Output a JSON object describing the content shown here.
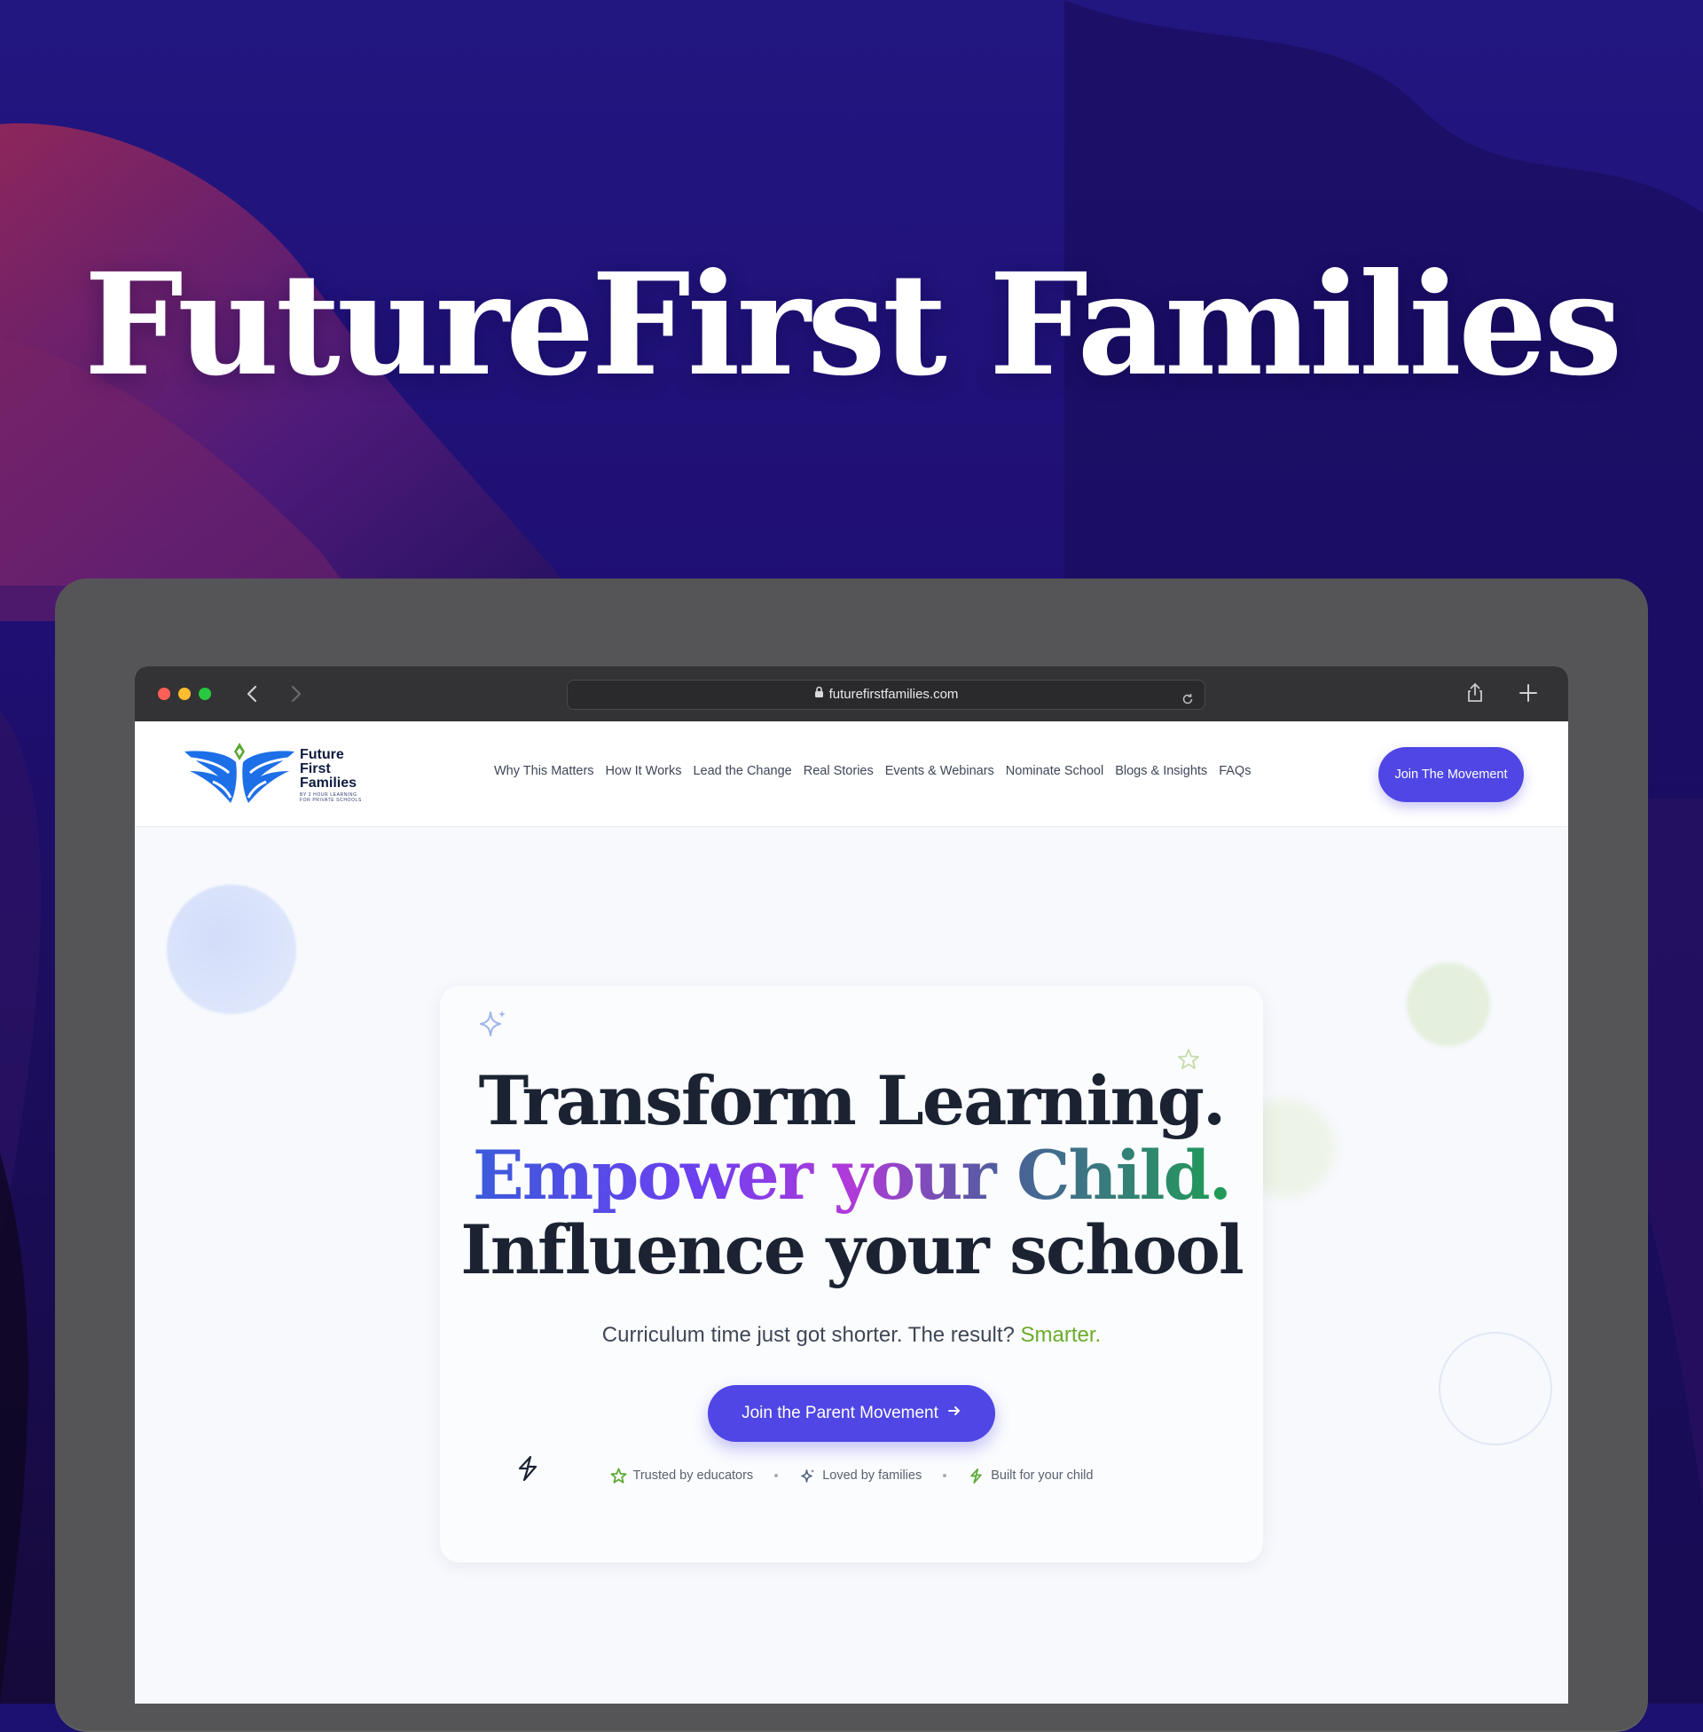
{
  "hero": {
    "title": "FutureFirst Families"
  },
  "browser": {
    "url": "futurefirstfamilies.com"
  },
  "site": {
    "logo": {
      "line1": "Future",
      "line2": "First",
      "line3": "Families",
      "tagline_line1": "BY 2 HOUR LEARNING",
      "tagline_line2": "FOR PRIVATE SCHOOLS"
    },
    "nav": [
      "Why This Matters",
      "How It Works",
      "Lead the Change",
      "Real Stories",
      "Events & Webinars",
      "Nominate School",
      "Blogs & Insights",
      "FAQs"
    ],
    "header_cta": "Join The Movement"
  },
  "card": {
    "headline_line1": "Transform Learning.",
    "headline_line2": "Empower your Child.",
    "headline_line3": "Influence your school",
    "subline": "Curriculum time just got shorter. The result?",
    "subline_accent": "Smarter.",
    "cta": "Join the Parent Movement",
    "badges": [
      "Trusted by educators",
      "Loved by families",
      "Built for your child"
    ]
  },
  "colors": {
    "accent": "#4f46e5",
    "green": "#6aad2a",
    "heading": "#1b2333"
  },
  "icons": [
    "lock-icon",
    "reload-icon",
    "share-icon",
    "plus-icon",
    "back-arrow-icon",
    "forward-arrow-icon",
    "sparkle-icon",
    "star-icon",
    "bolt-icon",
    "arrow-right-icon"
  ]
}
